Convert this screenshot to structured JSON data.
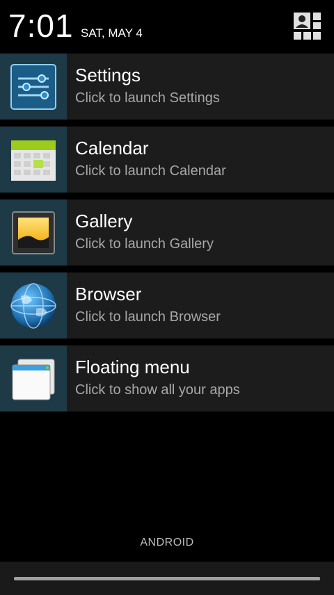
{
  "status": {
    "time": "7:01",
    "date": "SAT, MAY 4",
    "quick_settings_icon": "quick-settings-user-grid-icon"
  },
  "notifications": [
    {
      "title": "Settings",
      "subtitle": "Click to launch Settings",
      "icon": "settings-sliders-icon"
    },
    {
      "title": "Calendar",
      "subtitle": "Click to launch Calendar",
      "icon": "calendar-icon"
    },
    {
      "title": "Gallery",
      "subtitle": "Click to launch Gallery",
      "icon": "gallery-icon"
    },
    {
      "title": "Browser",
      "subtitle": "Click to launch Browser",
      "icon": "globe-icon"
    },
    {
      "title": "Floating menu",
      "subtitle": "Click to show all your apps",
      "icon": "floating-window-icon"
    }
  ],
  "footer": {
    "carrier": "ANDROID"
  },
  "colors": {
    "background": "#000000",
    "card": "#1c1c1c",
    "icon_tile": "#1e3a47",
    "subtitle": "#a8a8a8"
  }
}
